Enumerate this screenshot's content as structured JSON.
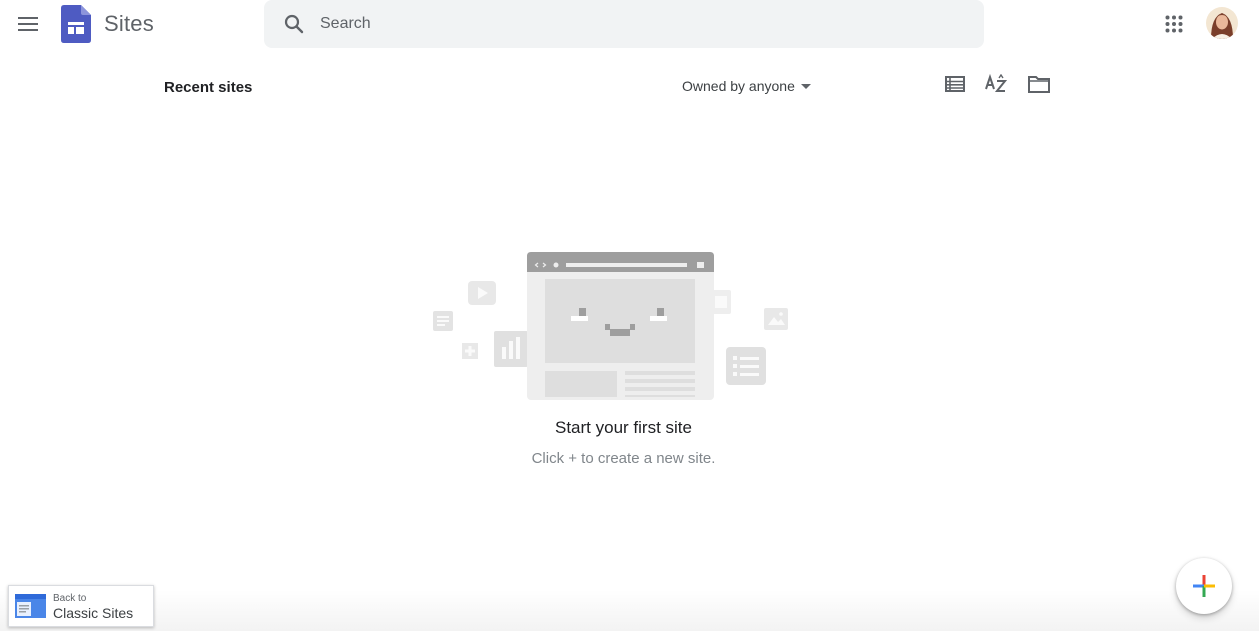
{
  "header": {
    "app_title": "Sites",
    "search_placeholder": "Search"
  },
  "toolbar": {
    "section_title": "Recent sites",
    "owner_filter": "Owned by anyone"
  },
  "empty_state": {
    "title": "Start your first site",
    "subtitle": "Click + to create a new site."
  },
  "classic_link": {
    "line1": "Back to",
    "line2": "Classic Sites"
  },
  "icons": {
    "menu": "hamburger-menu-icon",
    "logo": "google-sites-logo",
    "search": "search-icon",
    "apps": "apps-grid-icon",
    "list_view": "list-view-icon",
    "sort": "sort-az-icon",
    "folder": "folder-icon",
    "create": "plus-icon"
  },
  "colors": {
    "brand": "#4e5bc2",
    "search_bg": "#f1f3f4",
    "plus_blue": "#4285f4",
    "plus_red": "#ea4335",
    "plus_yellow": "#fbbc04",
    "plus_green": "#34a853"
  }
}
